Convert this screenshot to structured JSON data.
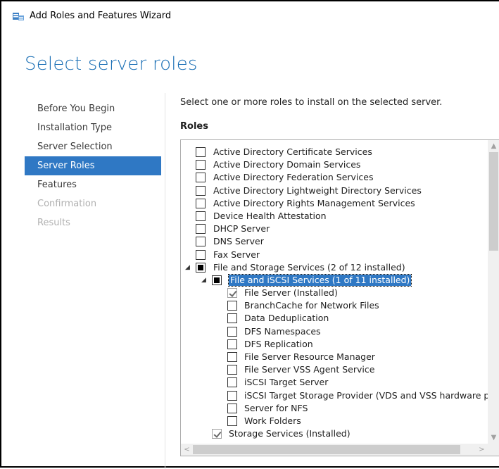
{
  "window": {
    "title": "Add Roles and Features Wizard",
    "icon": "server-manager-icon",
    "accent_color": "#2f78c4",
    "title_color": "#1a6fb5"
  },
  "page": {
    "title": "Select server roles",
    "instruction": "Select one or more roles to install on the selected server.",
    "roles_label": "Roles"
  },
  "nav": {
    "items": [
      {
        "label": "Before You Begin",
        "state": "normal"
      },
      {
        "label": "Installation Type",
        "state": "normal"
      },
      {
        "label": "Server Selection",
        "state": "normal"
      },
      {
        "label": "Server Roles",
        "state": "active"
      },
      {
        "label": "Features",
        "state": "normal"
      },
      {
        "label": "Confirmation",
        "state": "disabled"
      },
      {
        "label": "Results",
        "state": "disabled"
      }
    ]
  },
  "roles": [
    {
      "label": "Active Directory Certificate Services",
      "level": 0,
      "state": "unchecked"
    },
    {
      "label": "Active Directory Domain Services",
      "level": 0,
      "state": "unchecked"
    },
    {
      "label": "Active Directory Federation Services",
      "level": 0,
      "state": "unchecked"
    },
    {
      "label": "Active Directory Lightweight Directory Services",
      "level": 0,
      "state": "unchecked"
    },
    {
      "label": "Active Directory Rights Management Services",
      "level": 0,
      "state": "unchecked"
    },
    {
      "label": "Device Health Attestation",
      "level": 0,
      "state": "unchecked"
    },
    {
      "label": "DHCP Server",
      "level": 0,
      "state": "unchecked"
    },
    {
      "label": "DNS Server",
      "level": 0,
      "state": "unchecked"
    },
    {
      "label": "Fax Server",
      "level": 0,
      "state": "unchecked"
    },
    {
      "label": "File and Storage Services (2 of 12 installed)",
      "level": 0,
      "state": "partial",
      "expanded": true
    },
    {
      "label": "File and iSCSI Services (1 of 11 installed)",
      "level": 1,
      "state": "partial",
      "expanded": true,
      "selected": true
    },
    {
      "label": "File Server (Installed)",
      "level": 2,
      "state": "checked-disabled"
    },
    {
      "label": "BranchCache for Network Files",
      "level": 2,
      "state": "unchecked"
    },
    {
      "label": "Data Deduplication",
      "level": 2,
      "state": "unchecked"
    },
    {
      "label": "DFS Namespaces",
      "level": 2,
      "state": "unchecked"
    },
    {
      "label": "DFS Replication",
      "level": 2,
      "state": "unchecked"
    },
    {
      "label": "File Server Resource Manager",
      "level": 2,
      "state": "unchecked"
    },
    {
      "label": "File Server VSS Agent Service",
      "level": 2,
      "state": "unchecked"
    },
    {
      "label": "iSCSI Target Server",
      "level": 2,
      "state": "unchecked"
    },
    {
      "label": "iSCSI Target Storage Provider (VDS and VSS hardware pro",
      "level": 2,
      "state": "unchecked"
    },
    {
      "label": "Server for NFS",
      "level": 2,
      "state": "unchecked"
    },
    {
      "label": "Work Folders",
      "level": 2,
      "state": "unchecked"
    },
    {
      "label": "Storage Services (Installed)",
      "level": 1,
      "state": "checked-disabled"
    }
  ],
  "scrollbars": {
    "vertical_up": "▲",
    "vertical_down": "▼",
    "horizontal_left": "<",
    "horizontal_right": ">"
  }
}
